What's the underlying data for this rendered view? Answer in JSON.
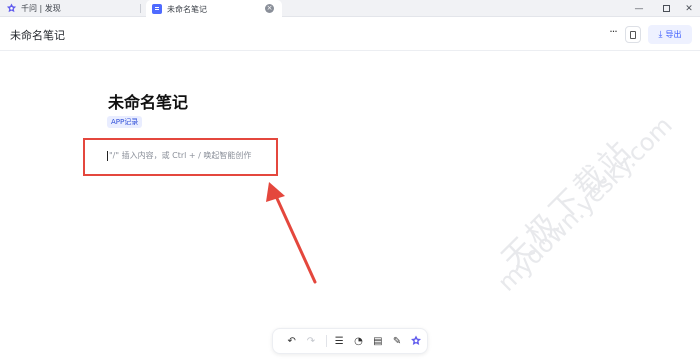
{
  "tabs": [
    {
      "label": "千问 | 发现",
      "active": false
    },
    {
      "label": "未命名笔记",
      "active": true
    }
  ],
  "header": {
    "title": "未命名笔记",
    "export_label": "导出"
  },
  "document": {
    "title": "未命名笔记",
    "badge": "APP记录",
    "placeholder": "\"/\" 插入内容，或 Ctrl + / 唤起智能创作"
  },
  "watermark": {
    "line1": "天极下载站",
    "line2": "mydown.yesky.com"
  },
  "toolbar": {
    "items": [
      "undo-icon",
      "redo-icon",
      "list-icon",
      "speed-icon",
      "note-icon",
      "magic-icon",
      "qianwen-logo"
    ]
  },
  "colors": {
    "accent": "#3b5bfd",
    "highlight": "#e4473d",
    "logo": "#615ced"
  }
}
